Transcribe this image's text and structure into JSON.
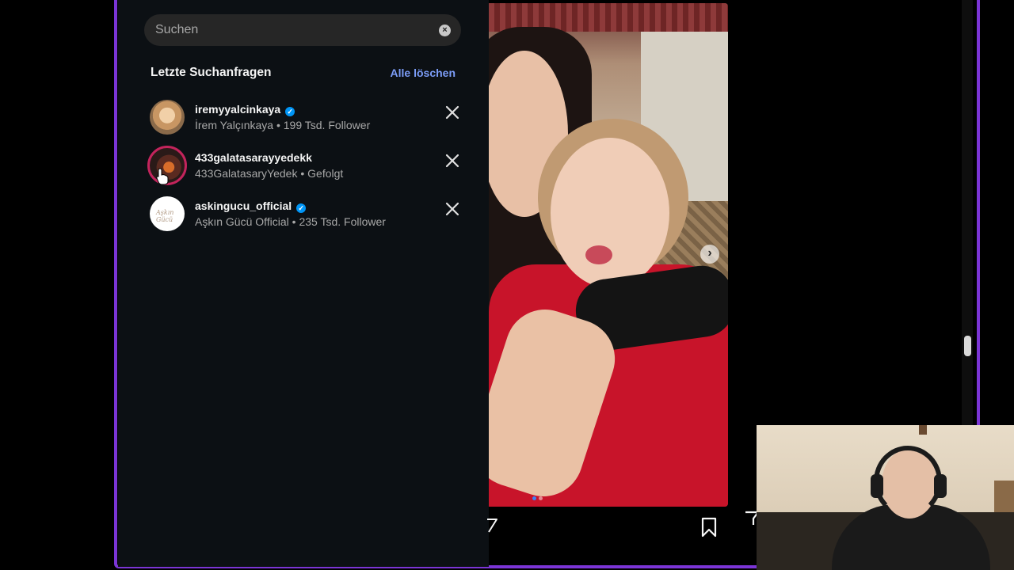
{
  "search": {
    "placeholder": "Suchen",
    "value": ""
  },
  "recent": {
    "title": "Letzte Suchanfragen",
    "clear_all_label": "Alle löschen",
    "items": [
      {
        "username": "iremyyalcinkaya",
        "verified": true,
        "subtitle": "İrem Yalçınkaya • 199 Tsd. Follower"
      },
      {
        "username": "433galatasarayyedekk",
        "verified": false,
        "subtitle": "433GalatasaryYedek • Gefolgt"
      },
      {
        "username": "askingucu_official",
        "verified": true,
        "subtitle": "Aşkın Gücü Official • 235 Tsd. Follower",
        "avatar_text": "Aşkın Gücü"
      }
    ]
  },
  "post": {
    "carousel_count": 2,
    "carousel_active": 1
  },
  "icons": {
    "clear": "clear-icon",
    "remove": "close-icon",
    "verified": "verified-badge-icon",
    "next": "chevron-right-icon",
    "bookmark": "bookmark-icon",
    "share": "share-icon"
  },
  "colors": {
    "accent_frame": "#7b35d6",
    "link": "#7c9df8",
    "verified": "#0095f6",
    "panel_bg": "#0c1014"
  }
}
